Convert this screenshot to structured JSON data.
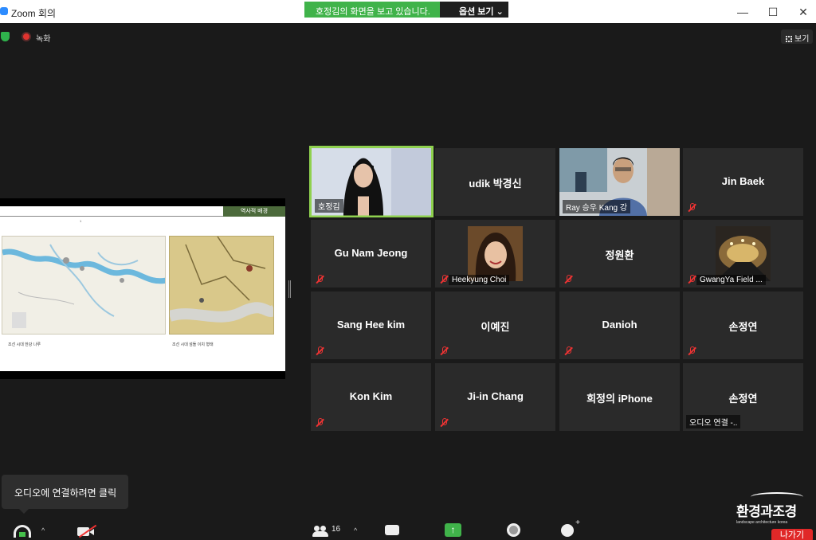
{
  "window": {
    "title": "Zoom 회의",
    "share_banner": "호정김의 화면을 보고 있습니다.",
    "options_label": "옵션 보기 ⌄",
    "minimize": "—",
    "maximize": "☐",
    "close": "✕"
  },
  "status": {
    "record_label": "녹화",
    "view_label": "보기"
  },
  "shared_slide": {
    "header_tag": "역사적 배경",
    "page_no": "1",
    "caption_left": "조선 시대 한강 나루",
    "caption_right": "조선 시대 섬돌 이치 형태"
  },
  "participants": {
    "tiles": [
      {
        "name": "호정김",
        "type": "video",
        "muted": false,
        "active": true
      },
      {
        "name": "udik 박경신",
        "type": "name",
        "muted": false
      },
      {
        "name": "Ray 승우 Kang 강",
        "type": "video",
        "muted": false
      },
      {
        "name": "Jin Baek",
        "type": "name",
        "muted": true
      },
      {
        "name": "Gu Nam Jeong",
        "type": "name",
        "muted": true
      },
      {
        "name": "Heekyung Choi",
        "type": "photo",
        "muted": true
      },
      {
        "name": "정원환",
        "type": "name",
        "muted": true
      },
      {
        "name": "GwangYa Field ...",
        "type": "photo",
        "muted": true
      },
      {
        "name": "Sang Hee kim",
        "type": "name",
        "muted": true
      },
      {
        "name": "이예진",
        "type": "name",
        "muted": true
      },
      {
        "name": "Danioh",
        "type": "name",
        "muted": true
      },
      {
        "name": "손정연",
        "type": "name",
        "muted": true
      },
      {
        "name": "Kon Kim",
        "type": "name",
        "muted": true
      },
      {
        "name": "Ji-in Chang",
        "type": "name",
        "muted": true
      },
      {
        "name": "희정의 iPhone",
        "type": "name",
        "muted": false
      },
      {
        "name": "손정연",
        "type": "name",
        "muted": false,
        "subtitle": "오디오 연결 -.."
      }
    ]
  },
  "audio_tooltip": "오디오에 연결하려면 클릭",
  "toolbar": {
    "participant_count": "16",
    "caret": "^",
    "share_arrow": "↑",
    "leave_label": "나가기"
  },
  "watermark": {
    "title": "환경과조경",
    "subtitle": "landscape architecture korea"
  },
  "colors": {
    "share_green": "#40b34a",
    "active_border": "#8fd14f",
    "mute_red": "#e33333",
    "leave_red": "#e02828"
  }
}
